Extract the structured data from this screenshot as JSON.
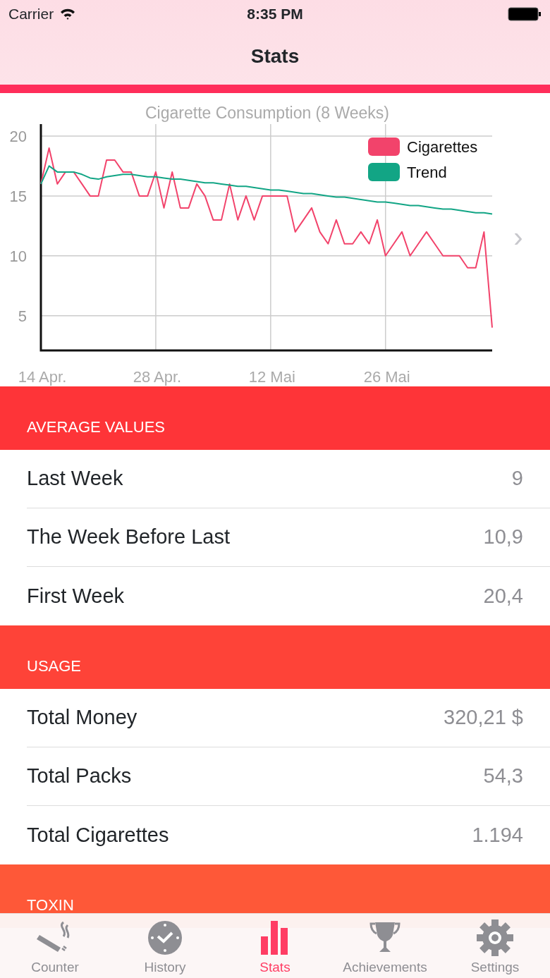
{
  "status_bar": {
    "carrier": "Carrier",
    "time": "8:35 PM"
  },
  "nav_bar": {
    "title": "Stats"
  },
  "chart": {
    "chart_data": {
      "type": "line",
      "title": "Cigarette Consumption (8 Weeks)",
      "categories": [
        "14 Apr.",
        null,
        null,
        null,
        null,
        null,
        null,
        null,
        null,
        null,
        null,
        null,
        null,
        null,
        "28 Apr.",
        null,
        null,
        null,
        null,
        null,
        null,
        null,
        null,
        null,
        null,
        null,
        null,
        null,
        "12 Mai",
        null,
        null,
        null,
        null,
        null,
        null,
        null,
        null,
        null,
        null,
        null,
        null,
        null,
        "26 Mai",
        null,
        null,
        null,
        null,
        null,
        null,
        null,
        null,
        null,
        null,
        null,
        null,
        null
      ],
      "ylim": [
        2.1,
        21
      ],
      "grid": true,
      "legend": "upper right",
      "yticks": [
        5,
        10,
        15,
        20
      ],
      "series": [
        {
          "name": "Cigarettes",
          "color": "#f2436b",
          "values": [
            16,
            19,
            16,
            17,
            17,
            16,
            15,
            15,
            18,
            18,
            17,
            17,
            15,
            15,
            17,
            14,
            17,
            14,
            14,
            16,
            15,
            13,
            13,
            16,
            13,
            15,
            13,
            15,
            15,
            15,
            15,
            12,
            13,
            14,
            12,
            11,
            13,
            11,
            11,
            12,
            11,
            13,
            10,
            11,
            12,
            10,
            11,
            12,
            11,
            10,
            10,
            10,
            9,
            9,
            12,
            4
          ]
        },
        {
          "name": "Trend",
          "color": "#12a585",
          "values": [
            16,
            17.5,
            17,
            17,
            17,
            16.8,
            16.5,
            16.4,
            16.6,
            16.7,
            16.8,
            16.8,
            16.7,
            16.6,
            16.6,
            16.5,
            16.4,
            16.4,
            16.3,
            16.2,
            16.1,
            16.1,
            16,
            15.9,
            15.8,
            15.8,
            15.7,
            15.6,
            15.5,
            15.5,
            15.4,
            15.3,
            15.2,
            15.2,
            15.1,
            15,
            14.9,
            14.9,
            14.8,
            14.7,
            14.6,
            14.5,
            14.5,
            14.4,
            14.3,
            14.2,
            14.2,
            14.1,
            14,
            13.9,
            13.9,
            13.8,
            13.7,
            13.6,
            13.6,
            13.5
          ]
        }
      ]
    },
    "next_arrow": "›"
  },
  "sections": [
    {
      "header": "AVERAGE VALUES",
      "color": "#fe3438",
      "rows": [
        {
          "label": "Last Week",
          "value": "9"
        },
        {
          "label": "The Week Before Last",
          "value": "10,9"
        },
        {
          "label": "First Week",
          "value": "20,4"
        }
      ]
    },
    {
      "header": "USAGE",
      "color": "#fe4338",
      "rows": [
        {
          "label": "Total Money",
          "value": "320,21 $"
        },
        {
          "label": "Total Packs",
          "value": "54,3"
        },
        {
          "label": "Total Cigarettes",
          "value": "1.194"
        }
      ]
    },
    {
      "header": "TOXIN",
      "color": "#fe5838"
    }
  ],
  "tab_bar": [
    {
      "label": "Counter",
      "selected": false
    },
    {
      "label": "History",
      "selected": false
    },
    {
      "label": "Stats",
      "selected": true
    },
    {
      "label": "Achievements",
      "selected": false
    },
    {
      "label": "Settings",
      "selected": false
    }
  ]
}
